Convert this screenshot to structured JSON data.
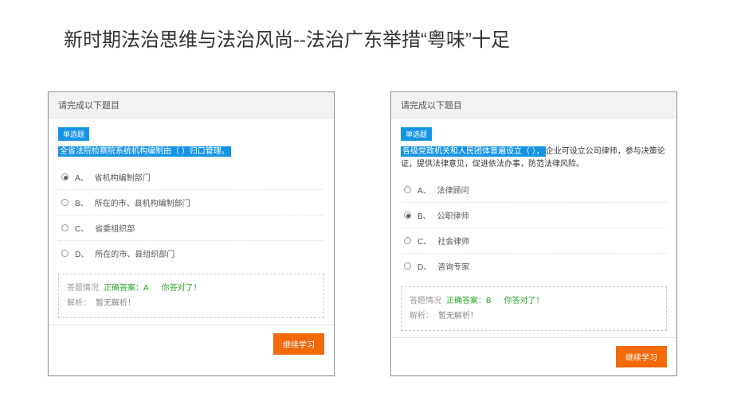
{
  "page_title": "新时期法治思维与法治风尚--法治广东举措“粤味”十足",
  "left": {
    "header": "请完成以下题目",
    "tag": "单选题",
    "stem_hl": "全省法院检察院系统机构编制由（  ）归口管理。",
    "options": [
      {
        "letter": "A、",
        "text": "省机构编制部门",
        "checked": true
      },
      {
        "letter": "B、",
        "text": "所在的市、县机构编制部门",
        "checked": false
      },
      {
        "letter": "C、",
        "text": "省委组织部",
        "checked": false
      },
      {
        "letter": "D、",
        "text": "所在的市、县组织部门",
        "checked": false
      }
    ],
    "fb_label": "答题情况",
    "fb_correct": "正确答案：A",
    "fb_praise": "你答对了！",
    "fb_analysis_label": "解析：",
    "fb_analysis": "暂无解析！",
    "btn": "继续学习"
  },
  "right": {
    "header": "请完成以下题目",
    "tag": "单选题",
    "stem_hl": "各级党政机关和人民团体普遍设立（  ），",
    "stem_tail": "企业可设立公司律师，参与决策论证，提供法律意见，促进依法办事，防范法律风险。",
    "options": [
      {
        "letter": "A、",
        "text": "法律顾问",
        "checked": false
      },
      {
        "letter": "B、",
        "text": "公职律师",
        "checked": true
      },
      {
        "letter": "C、",
        "text": "社会律师",
        "checked": false
      },
      {
        "letter": "D、",
        "text": "咨询专家",
        "checked": false
      }
    ],
    "fb_label": "答题情况",
    "fb_correct": "正确答案：B",
    "fb_praise": "你答对了！",
    "fb_analysis_label": "解析：",
    "fb_analysis": "暂无解析！",
    "btn": "继续学习"
  }
}
